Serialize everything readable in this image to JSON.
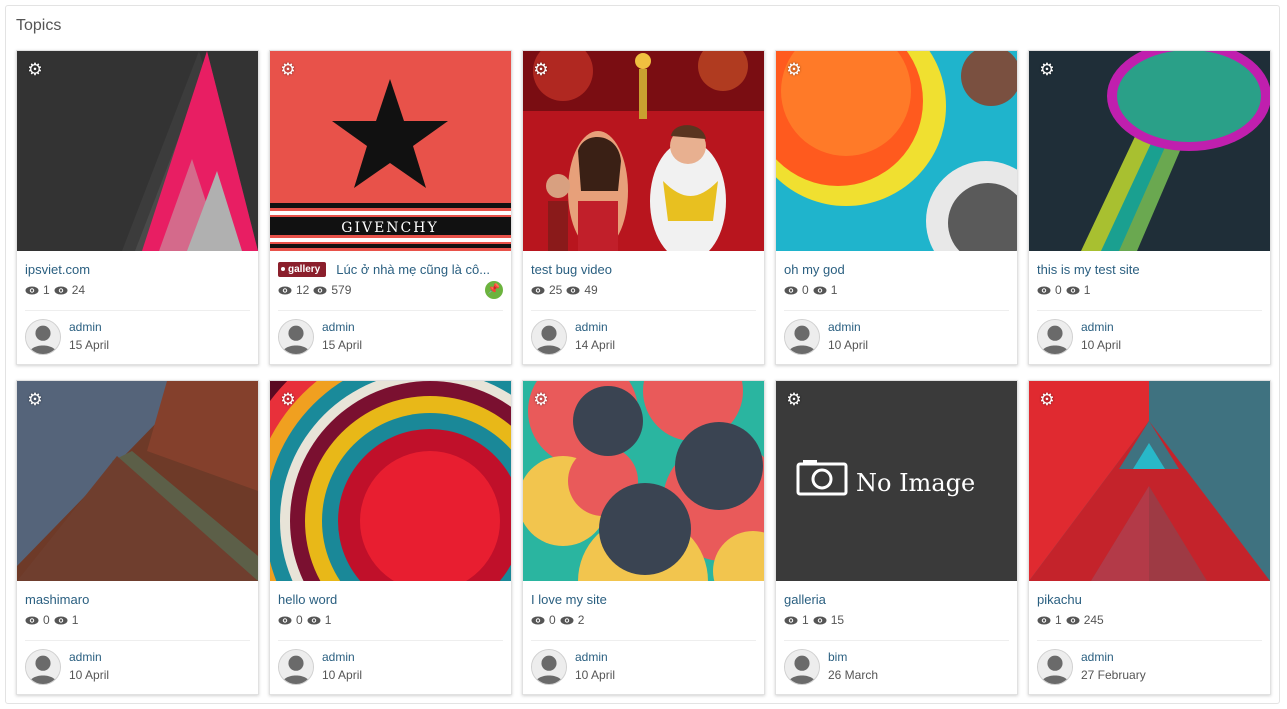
{
  "panel": {
    "title": "Topics"
  },
  "colors": {
    "link": "#2a5f80",
    "tag": "#8b1f2c",
    "pin": "#6cb33e"
  },
  "cards": [
    {
      "title": "ipsviet.com",
      "tag": "",
      "pinned": false,
      "views": "1",
      "replies": "24",
      "author": "admin",
      "date": "15 April",
      "image": "triangles-pink"
    },
    {
      "title": "Lúc ở nhà mẹ cũng là cô...",
      "tag": "gallery",
      "pinned": true,
      "views": "12",
      "replies": "579",
      "author": "admin",
      "date": "15 April",
      "image": "givenchy-star"
    },
    {
      "title": "test bug video",
      "tag": "",
      "pinned": false,
      "views": "25",
      "replies": "49",
      "author": "admin",
      "date": "14 April",
      "image": "celebration-photo"
    },
    {
      "title": "oh my god",
      "tag": "",
      "pinned": false,
      "views": "0",
      "replies": "1",
      "author": "admin",
      "date": "10 April",
      "image": "circles-orange"
    },
    {
      "title": "this is my test site",
      "tag": "",
      "pinned": false,
      "views": "0",
      "replies": "1",
      "author": "admin",
      "date": "10 April",
      "image": "circle-magenta"
    },
    {
      "title": "mashimaro",
      "tag": "",
      "pinned": false,
      "views": "0",
      "replies": "1",
      "author": "admin",
      "date": "10 April",
      "image": "material-brown"
    },
    {
      "title": "hello word",
      "tag": "",
      "pinned": false,
      "views": "0",
      "replies": "1",
      "author": "admin",
      "date": "10 April",
      "image": "rainbow-arcs"
    },
    {
      "title": "I love my site",
      "tag": "",
      "pinned": false,
      "views": "0",
      "replies": "2",
      "author": "admin",
      "date": "10 April",
      "image": "dots-pattern"
    },
    {
      "title": "galleria",
      "tag": "",
      "pinned": false,
      "views": "1",
      "replies": "15",
      "author": "bim",
      "date": "26 March",
      "image": "no-image",
      "placeholder_text": "No Image"
    },
    {
      "title": "pikachu",
      "tag": "",
      "pinned": false,
      "views": "1",
      "replies": "245",
      "author": "admin",
      "date": "27 February",
      "image": "triangles-red"
    }
  ]
}
